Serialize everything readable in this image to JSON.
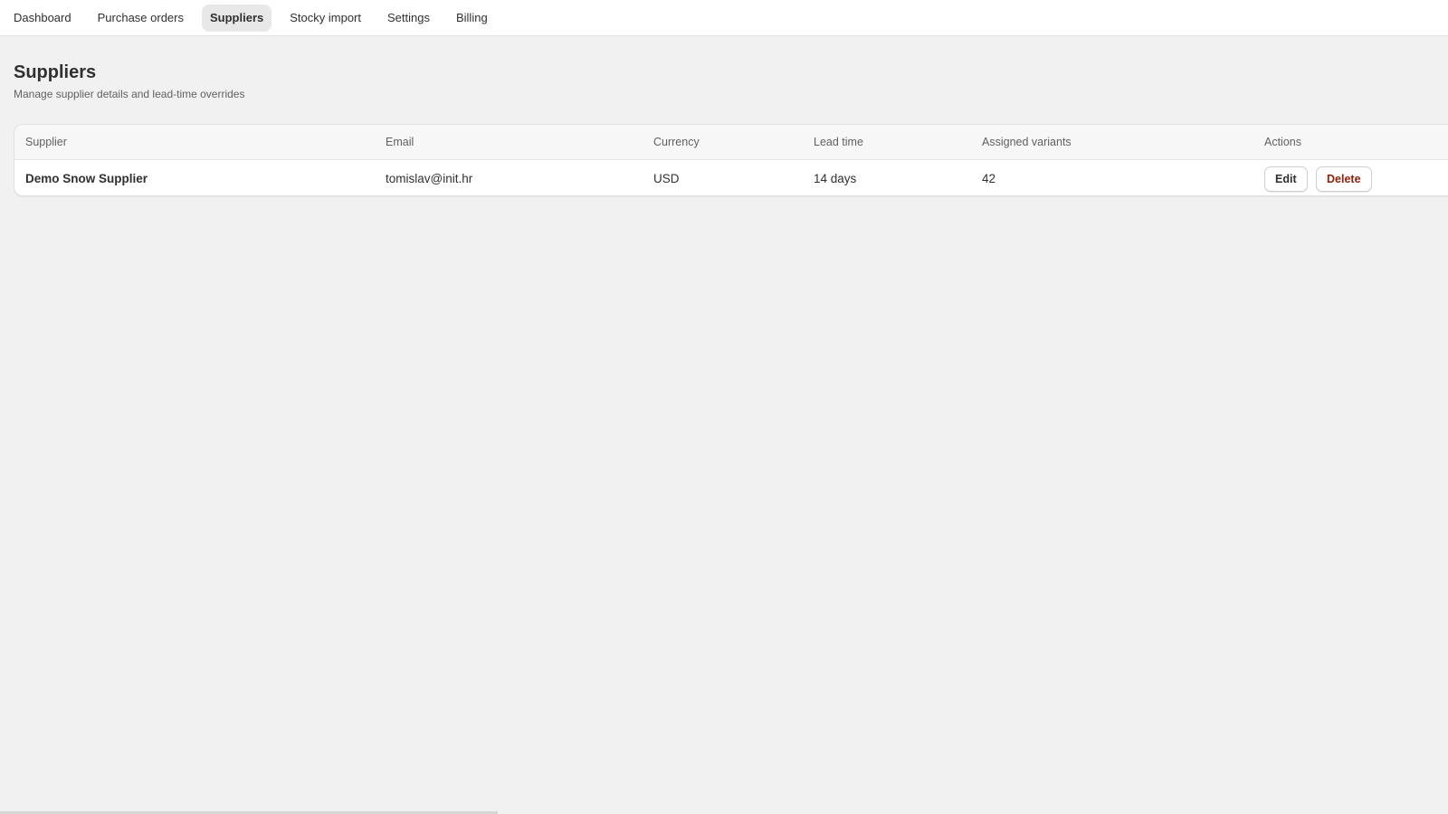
{
  "nav": {
    "tabs": [
      {
        "label": "Dashboard"
      },
      {
        "label": "Purchase orders"
      },
      {
        "label": "Suppliers"
      },
      {
        "label": "Stocky import"
      },
      {
        "label": "Settings"
      },
      {
        "label": "Billing"
      }
    ],
    "active_tab": "Suppliers"
  },
  "page": {
    "title": "Suppliers",
    "subtitle": "Manage supplier details and lead-time overrides"
  },
  "table": {
    "columns": [
      "Supplier",
      "Email",
      "Currency",
      "Lead time",
      "Assigned variants",
      "Actions"
    ],
    "rows": [
      {
        "supplier": "Demo Snow Supplier",
        "email": "tomislav@init.hr",
        "currency": "USD",
        "lead_time": "14 days",
        "assigned_variants": "42",
        "edit_label": "Edit",
        "delete_label": "Delete"
      }
    ]
  },
  "colors": {
    "background": "#f1f1f1",
    "active_tab_bg": "#e8e8e8",
    "danger_text": "#8e1f0b"
  }
}
